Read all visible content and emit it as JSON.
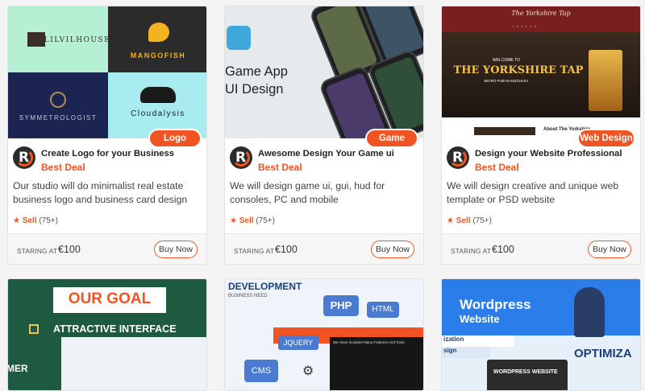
{
  "cards": [
    {
      "category": "Logo",
      "title": "Create Logo for your Business",
      "deal": "Best Deal",
      "description": "Our studio will do minimalist real estate business logo and business card design",
      "sell_label": "Sell",
      "sell_count": "(75+)",
      "staring_label": "STARING AT",
      "price": "€100",
      "buy_label": "Buy Now",
      "thumb": {
        "logos": [
          "LILVILHOUSE",
          "MANGOFISH",
          "SYMMETROLOGIST",
          "Cloudalysis"
        ]
      }
    },
    {
      "category": "Game",
      "title": "Awesome Design Your Game ui",
      "deal": "Best Deal",
      "description": "We will design game ui, gui, hud for consoles, PC and mobile",
      "sell_label": "Sell",
      "sell_count": "(75+)",
      "staring_label": "STARING AT",
      "price": "€100",
      "buy_label": "Buy Now",
      "thumb": {
        "line1": "Game App",
        "line2": "UI Design"
      }
    },
    {
      "category": "Web Design",
      "title": "Design your Website Professional",
      "deal": "Best Deal",
      "description": "We will design creative and unique web template or PSD website",
      "sell_label": "Sell",
      "sell_count": "(75+)",
      "staring_label": "STARING AT",
      "price": "€100",
      "buy_label": "Buy Now",
      "thumb": {
        "brand": "The Yorkshire Tap",
        "welcome": "WELCOME TO",
        "headline": "THE YORKSHIRE TAP",
        "tagline": "MICRO PUB IN KEIGHLEY",
        "about": "About The Yorkshire"
      }
    }
  ],
  "bottom_cards": [
    {
      "line1": "OUR GOAL",
      "line2": "ATTRACTIVE INTERFACE",
      "side": "MER"
    },
    {
      "line1": "DEVELOPMENT",
      "line2": "BUSINESS NEED",
      "tags": [
        "PHP",
        "HTML",
        "JQUERY",
        "CMS"
      ],
      "strip": "We Have Included Many Features And Tools"
    },
    {
      "line1": "Wordpress",
      "line2": "Website",
      "tags": [
        "ization",
        "sign",
        "OPTIMIZA",
        "WORDPRESS WEBSITE"
      ]
    }
  ],
  "colors": {
    "accent": "#f05423",
    "dark": "#2b2b2b"
  },
  "icons": {
    "star": "★"
  }
}
